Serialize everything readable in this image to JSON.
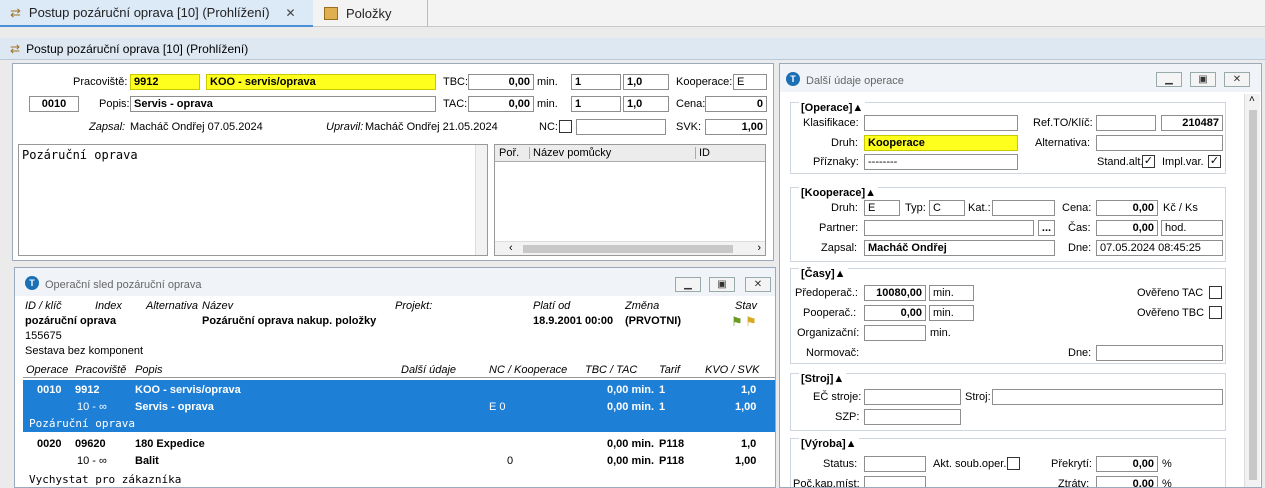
{
  "tabs": [
    {
      "label": "Postup pozáruční oprava  [10] (Prohlížení)",
      "close": "✕"
    },
    {
      "label": "Položky"
    }
  ],
  "window_title": "Postup pozáruční oprava  [10] (Prohlížení)",
  "header": {
    "pracoviste_label": "Pracoviště:",
    "pracoviste_code": "9912",
    "pracoviste_name": "KOO - servis/oprava",
    "tbc_label": "TBC:",
    "tbc_value": "0,00",
    "tbc_unit": "min.",
    "tbc_q1": "1",
    "tbc_q2": "1,0",
    "kooperace_label": "Kooperace:",
    "kooperace_value": "E",
    "op_number": "0010",
    "popis_label": "Popis:",
    "popis_value": "Servis - oprava",
    "tac_label": "TAC:",
    "tac_value": "0,00",
    "tac_unit": "min.",
    "tac_q1": "1",
    "tac_q2": "1,0",
    "cena_label": "Cena:",
    "cena_value": "0",
    "zapsal_label": "Zapsal:",
    "zapsal_value": "Macháč Ondřej 07.05.2024",
    "upravil_label": "Upravil:",
    "upravil_value": "Macháč Ondřej 21.05.2024",
    "nc_label": "NC:",
    "svk_label": "SVK:",
    "svk_value": "1,00",
    "note": "Pozáruční oprava",
    "tools_cols": [
      "Poř.",
      "Název pomůcky",
      "ID"
    ]
  },
  "sequence": {
    "title": "Operační sled pozáruční oprava",
    "info_headers": [
      "ID / klíč",
      "Index",
      "Alternativa",
      "Název",
      "Projekt:",
      "Platí od",
      "Změna",
      "Stav"
    ],
    "id_key": "pozáruční oprava",
    "nazev": "Pozáruční oprava nakup. položky",
    "plati_od": "18.9.2001 00:00",
    "zmena": "(PRVOTNI)",
    "id_num": "155675",
    "sestava": "Sestava bez komponent",
    "cols": [
      "Operace",
      "Pracoviště",
      "Popis",
      "Další údaje",
      "NC / Kooperace",
      "TBC / TAC",
      "Tarif",
      "KVO / SVK"
    ],
    "rows": [
      {
        "op": "0010",
        "prac": "9912",
        "popis1": "KOO - servis/oprava",
        "range": "10 - ∞",
        "popis2": "Servis - oprava",
        "nc": "E   0",
        "tbc": "0,00 min.",
        "tac": "0,00 min.",
        "tarif1": "1",
        "tarif2": "1",
        "kvo": "1,0",
        "svk": "1,00",
        "note": "Pozáruční oprava"
      },
      {
        "op": "0020",
        "prac": "09620",
        "popis1": "180 Expedice",
        "range": "10 - ∞",
        "popis2": "Balit",
        "nc": "0",
        "tbc": "0,00 min.",
        "tac": "0,00 min.",
        "tarif1": "P118",
        "tarif2": "P118",
        "kvo": "1,0",
        "svk": "1,00",
        "note": "Vychystat pro zákazníka"
      }
    ]
  },
  "detail": {
    "title": "Další údaje operace",
    "operace": {
      "head": "[Operace]▲",
      "klasifikace": "Klasifikace:",
      "ref_label": "Ref.TO/Klíč:",
      "ref_value": "210487",
      "druh": "Druh:",
      "druh_value": "Kooperace",
      "alternativa": "Alternativa:",
      "priznaky": "Příznaky:",
      "priznaky_value": "--------",
      "stand": "Stand.alt.",
      "impl": "Impl.var."
    },
    "kooperace": {
      "head": "[Kooperace]▲",
      "druh": "Druh:",
      "druh_value": "E",
      "typ": "Typ:",
      "typ_value": "C",
      "kat": "Kat.:",
      "cena": "Cena:",
      "cena_value": "0,00",
      "cena_unit": "Kč / Ks",
      "partner": "Partner:",
      "cas": "Čas:",
      "cas_value": "0,00",
      "cas_unit": "hod.",
      "zapsal": "Zapsal:",
      "zapsal_value": "Macháč Ondřej",
      "dne": "Dne:",
      "dne_value": "07.05.2024 08:45:25",
      "btn": "..."
    },
    "casy": {
      "head": "[Časy]▲",
      "predoperac": "Předoperač.:",
      "predoperac_value": "10080,00",
      "pooperac": "Pooperač.:",
      "pooperac_value": "0,00",
      "organizacni": "Organizační:",
      "min": "min.",
      "normovac": "Normovač:",
      "dne": "Dne:",
      "overeno_tac": "Ověřeno TAC",
      "overeno_tbc": "Ověřeno TBC"
    },
    "stroj": {
      "head": "[Stroj]▲",
      "ec": "EČ stroje:",
      "stroj": "Stroj:",
      "szp": "SZP:"
    },
    "vyroba": {
      "head": "[Výroba]▲",
      "status": "Status:",
      "akt": "Akt. soub.oper.",
      "prekryti": "Překrytí:",
      "prekryti_value": "0,00",
      "ztraty": "Ztráty:",
      "ztraty_value": "0,00",
      "pct": "%",
      "poc": "Poč.kap.míst:"
    }
  }
}
